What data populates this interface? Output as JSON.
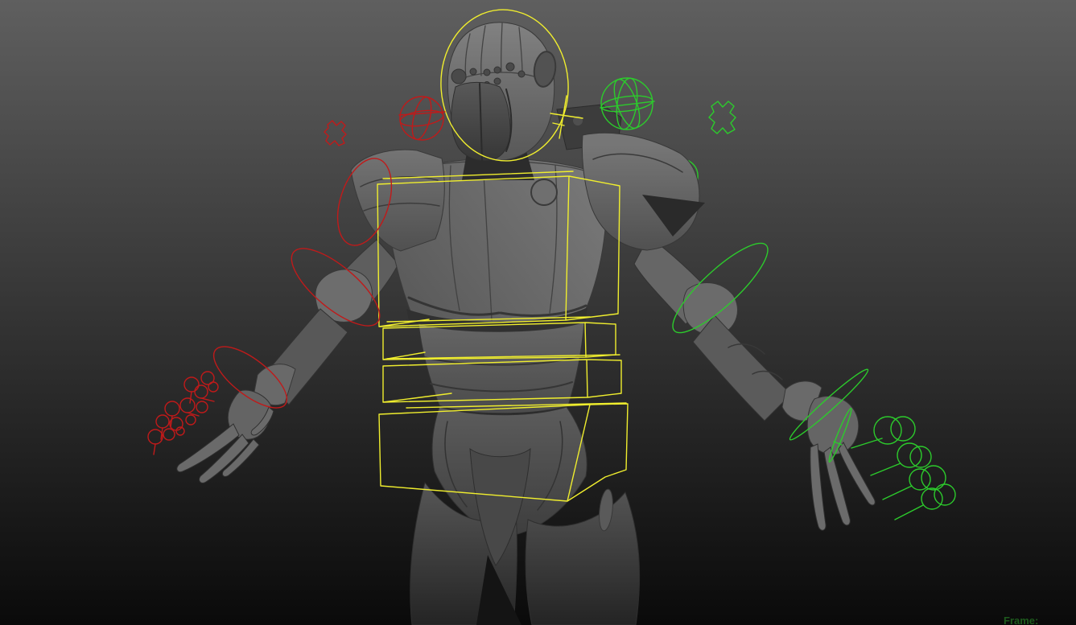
{
  "viewport": {
    "bg_top": "#5f5f5f",
    "bg_bottom": "#0a0a0a"
  },
  "hud": {
    "frame_label": "Frame:",
    "frame_color": "#1d5a1d"
  },
  "rig": {
    "colors": {
      "center_yellow": "#f0ee2e",
      "left_red": "#c01a1a",
      "right_green": "#2ccb2c"
    }
  },
  "model": {
    "name": "robot-character",
    "base_gray": "#6e6e6e"
  }
}
